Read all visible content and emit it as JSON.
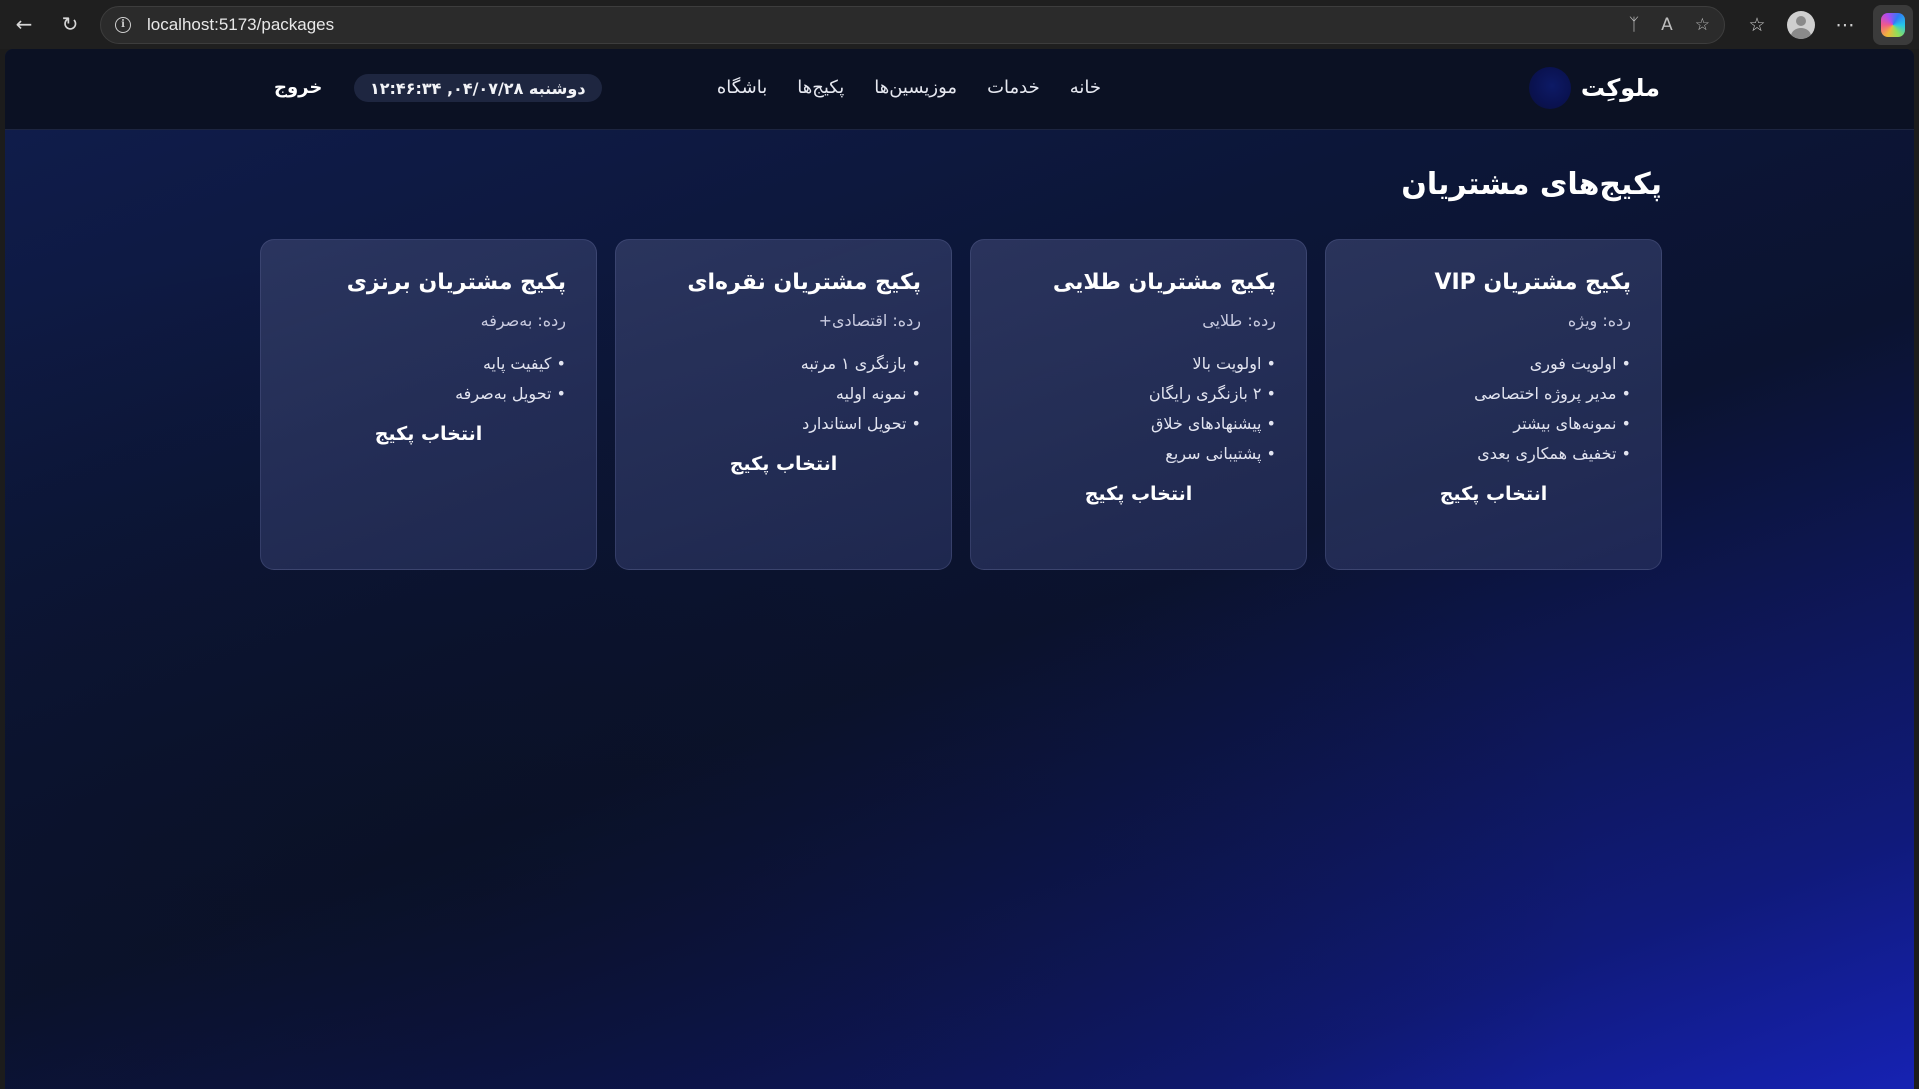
{
  "browser": {
    "url": "localhost:5173/packages"
  },
  "header": {
    "brand": "ملوکِت",
    "nav": [
      "خانه",
      "خدمات",
      "موزیسین‌ها",
      "پکیج‌ها",
      "باشگاه"
    ],
    "datetime": "دوشنبه ۰۴/۰۷/۲۸, ۱۲:۴۶:۳۴",
    "logout": "خروج"
  },
  "main": {
    "title": "پکیج‌های مشتریان",
    "cards": [
      {
        "title": "پکیج مشتریان VIP",
        "tier": "رده: ویژه",
        "features": [
          "اولویت فوری",
          "مدیر پروژه اختصاصی",
          "نمونه‌های بیشتر",
          "تخفیف همکاری بعدی"
        ],
        "button": "انتخاب پکیج"
      },
      {
        "title": "پکیج مشتریان طلایی",
        "tier": "رده: طلایی",
        "features": [
          "اولویت بالا",
          "۲ بازنگری رایگان",
          "پیشنهادهای خلاق",
          "پشتیبانی سریع"
        ],
        "button": "انتخاب پکیج"
      },
      {
        "title": "پکیج مشتریان نقره‌ای",
        "tier": "رده: اقتصادی+",
        "features": [
          "بازنگری ۱ مرتبه",
          "نمونه اولیه",
          "تحویل استاندارد"
        ],
        "button": "انتخاب پکیج"
      },
      {
        "title": "پکیج مشتریان برنزی",
        "tier": "رده: به‌صرفه",
        "features": [
          "کیفیت پایه",
          "تحویل به‌صرفه"
        ],
        "button": "انتخاب پکیج"
      }
    ]
  }
}
